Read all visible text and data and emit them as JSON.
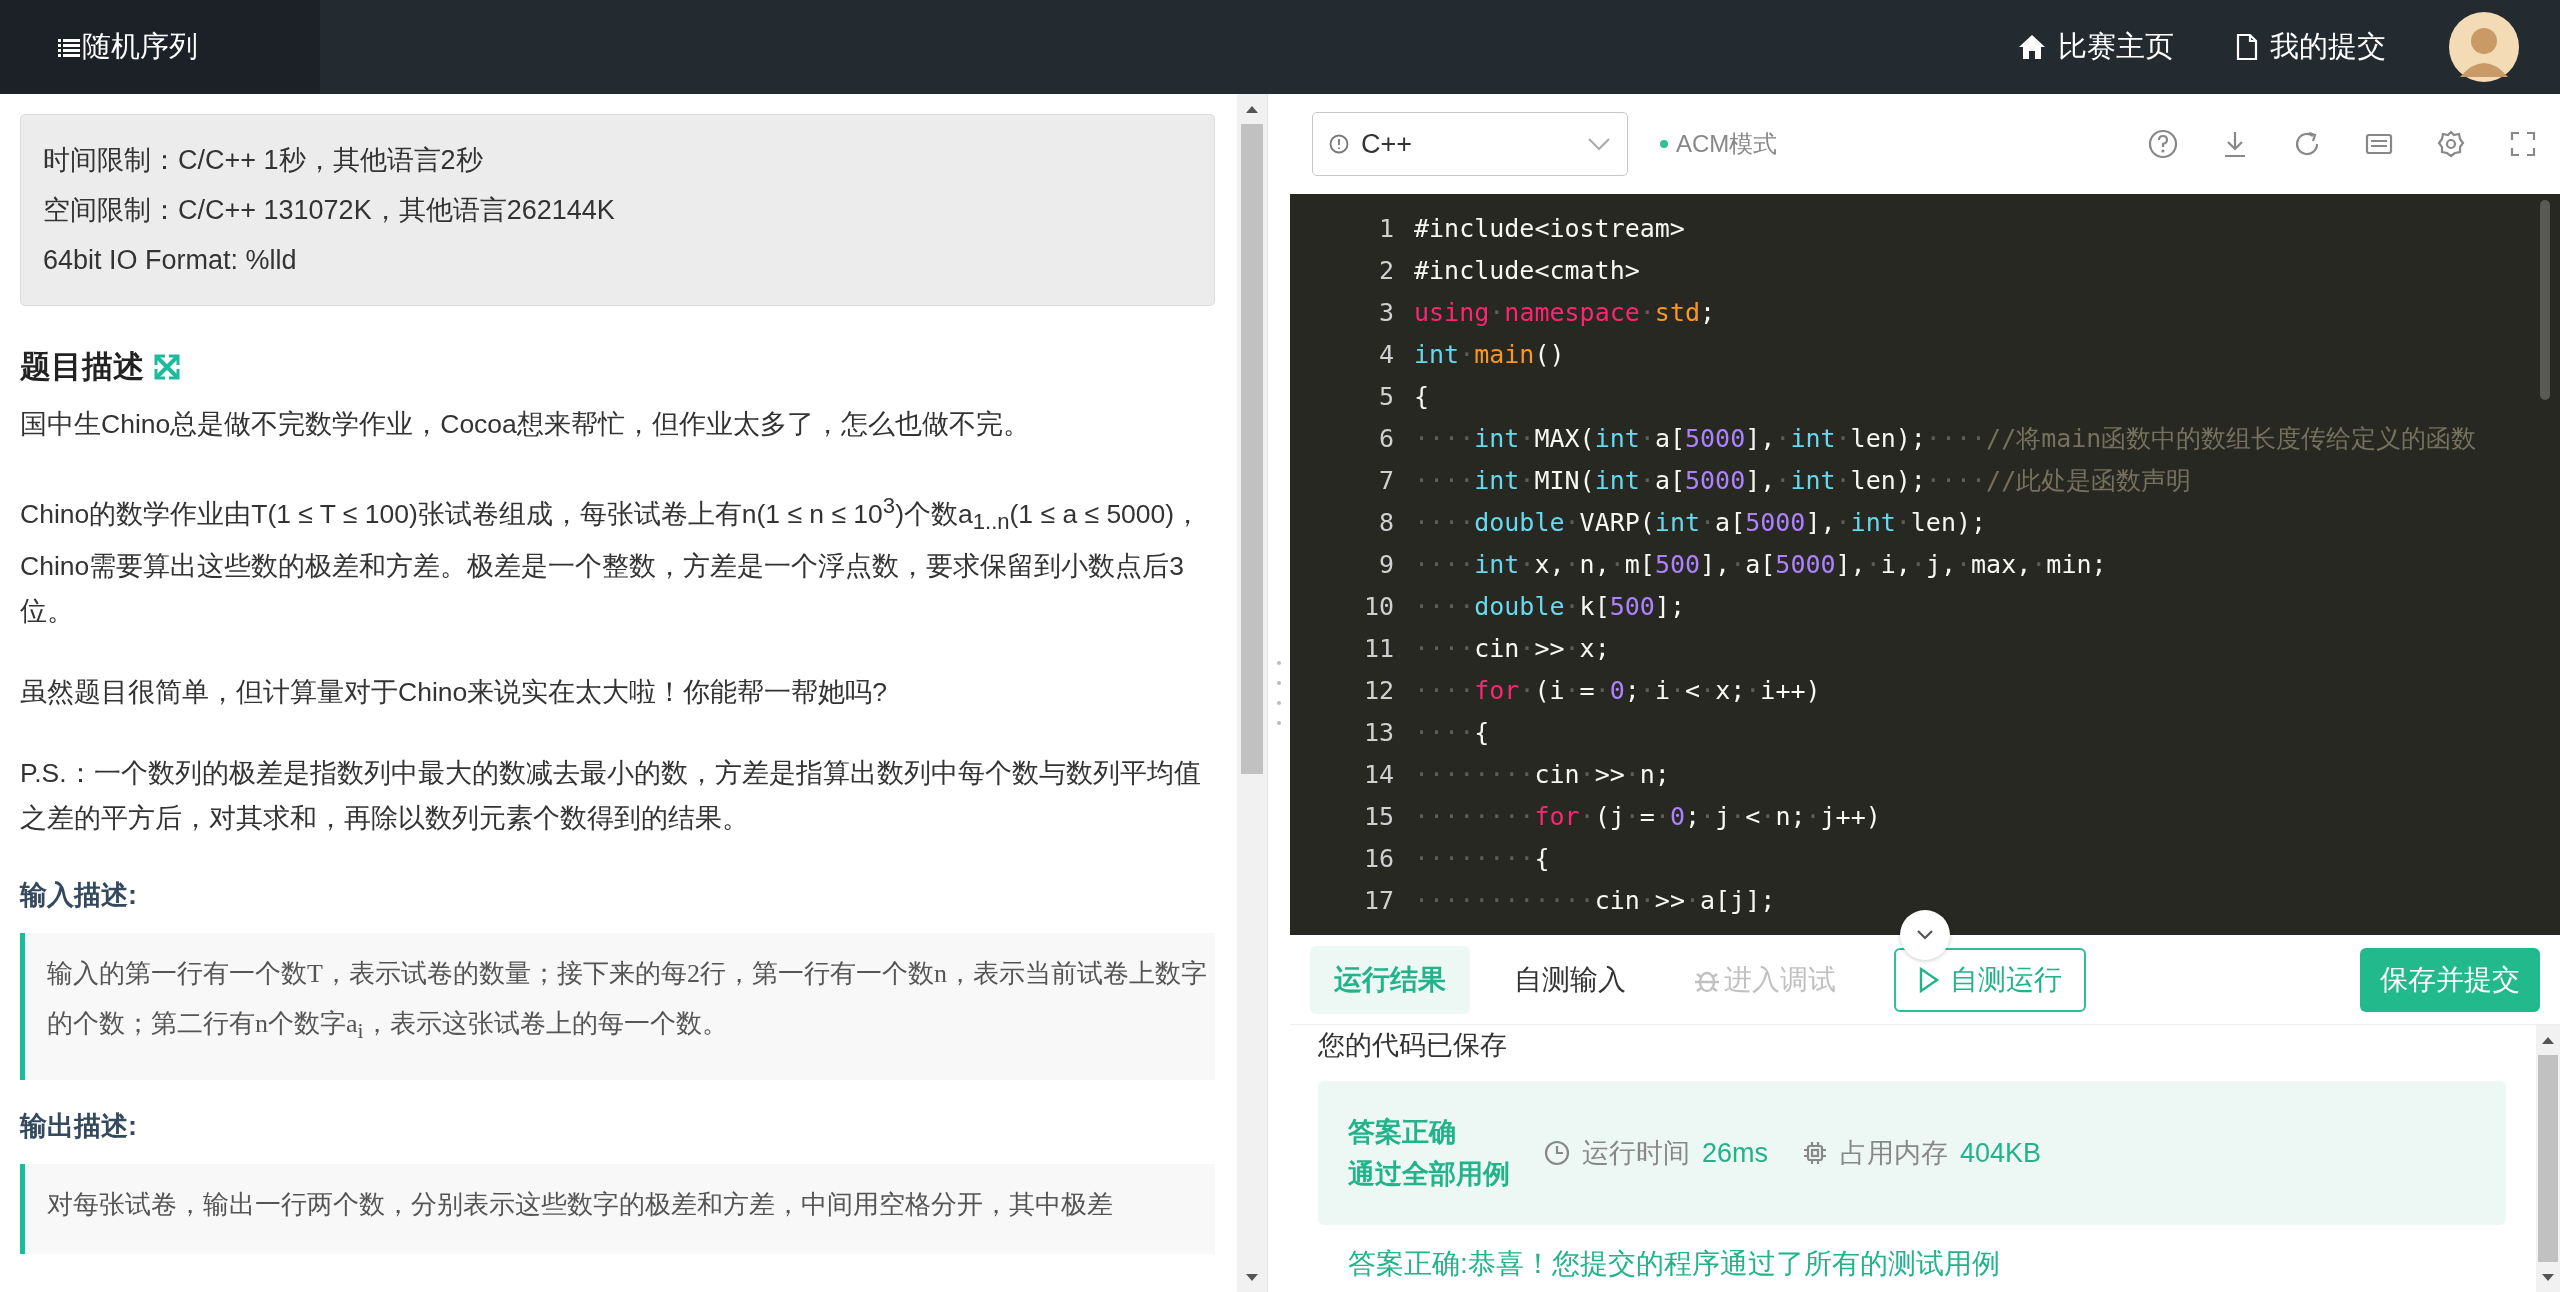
{
  "top_bar": {
    "title": "随机序列",
    "nav": [
      "比赛主页",
      "我的提交"
    ]
  },
  "limits": [
    "时间限制：C/C++ 1秒，其他语言2秒",
    "空间限制：C/C++ 131072K，其他语言262144K",
    "64bit IO Format: %lld"
  ],
  "description": {
    "heading": "题目描述",
    "paragraphs": [
      "国中生Chino总是做不完数学作业，Cocoa想来帮忙，但作业太多了，怎么也做不完。",
      "Chino的数学作业由T(1 ≤ T ≤ 100)张试卷组成，每张试卷上有n(1 ≤ n ≤ 10$^{3}$)个数a$_{1..n}$(1 ≤ a ≤ 5000)，Chino需要算出这些数的极差和方差。极差是一个整数，方差是一个浮点数，要求保留到小数点后3位。",
      "虽然题目很简单，但计算量对于Chino来说实在太大啦！你能帮一帮她吗?",
      "P.S.：一个数列的极差是指数列中最大的数减去最小的数，方差是指算出数列中每个数与数列平均值之差的平方后，对其求和，再除以数列元素个数得到的结果。"
    ]
  },
  "input_description": {
    "heading": "输入描述:",
    "text": "输入的第一行有一个数T，表示试卷的数量；接下来的每2行，第一行有一个数n，表示当前试卷上数字的个数；第二行有n个数字a$_{i}$，表示这张试卷上的每一个数。"
  },
  "output_description": {
    "heading": "输出描述:",
    "text": "对每张试卷，输出一行两个数，分别表示这些数字的极差和方差，中间用空格分开，其中极差"
  },
  "editor": {
    "language": "C++",
    "mode": "ACM模式",
    "lines": [
      {
        "number": "1",
        "tokens": [
          {
            "kind": "plain",
            "text": "#include<iostream>"
          }
        ]
      },
      {
        "number": "2",
        "tokens": [
          {
            "kind": "plain",
            "text": "#include<cmath>"
          }
        ]
      },
      {
        "number": "3",
        "tokens": [
          {
            "kind": "kw",
            "text": "using"
          },
          {
            "kind": "ws",
            "text": "·"
          },
          {
            "kind": "kw",
            "text": "namespace"
          },
          {
            "kind": "ws",
            "text": "·"
          },
          {
            "kind": "fn",
            "text": "std"
          },
          {
            "kind": "plain",
            "text": ";"
          }
        ]
      },
      {
        "number": "4",
        "tokens": [
          {
            "kind": "type",
            "text": "int"
          },
          {
            "kind": "ws",
            "text": "·"
          },
          {
            "kind": "fn",
            "text": "main"
          },
          {
            "kind": "plain",
            "text": "()"
          }
        ]
      },
      {
        "number": "5",
        "tokens": [
          {
            "kind": "plain",
            "text": "{"
          }
        ]
      },
      {
        "number": "6",
        "tokens": [
          {
            "kind": "ws",
            "text": "····"
          },
          {
            "kind": "type",
            "text": "int"
          },
          {
            "kind": "ws",
            "text": "·"
          },
          {
            "kind": "plain",
            "text": "MAX("
          },
          {
            "kind": "type",
            "text": "int"
          },
          {
            "kind": "ws",
            "text": "·"
          },
          {
            "kind": "plain",
            "text": "a["
          },
          {
            "kind": "num",
            "text": "5000"
          },
          {
            "kind": "plain",
            "text": "],"
          },
          {
            "kind": "ws",
            "text": "·"
          },
          {
            "kind": "type",
            "text": "int"
          },
          {
            "kind": "ws",
            "text": "·"
          },
          {
            "kind": "plain",
            "text": "len);"
          },
          {
            "kind": "ws",
            "text": "····"
          },
          {
            "kind": "comment",
            "text": "//将main函数中的数组长度传给定义的函数"
          }
        ]
      },
      {
        "number": "7",
        "tokens": [
          {
            "kind": "ws",
            "text": "····"
          },
          {
            "kind": "type",
            "text": "int"
          },
          {
            "kind": "ws",
            "text": "·"
          },
          {
            "kind": "plain",
            "text": "MIN("
          },
          {
            "kind": "type",
            "text": "int"
          },
          {
            "kind": "ws",
            "text": "·"
          },
          {
            "kind": "plain",
            "text": "a["
          },
          {
            "kind": "num",
            "text": "5000"
          },
          {
            "kind": "plain",
            "text": "],"
          },
          {
            "kind": "ws",
            "text": "·"
          },
          {
            "kind": "type",
            "text": "int"
          },
          {
            "kind": "ws",
            "text": "·"
          },
          {
            "kind": "plain",
            "text": "len);"
          },
          {
            "kind": "ws",
            "text": "····"
          },
          {
            "kind": "comment",
            "text": "//此处是函数声明"
          }
        ]
      },
      {
        "number": "8",
        "tokens": [
          {
            "kind": "ws",
            "text": "····"
          },
          {
            "kind": "type",
            "text": "double"
          },
          {
            "kind": "ws",
            "text": "·"
          },
          {
            "kind": "plain",
            "text": "VARP("
          },
          {
            "kind": "type",
            "text": "int"
          },
          {
            "kind": "ws",
            "text": "·"
          },
          {
            "kind": "plain",
            "text": "a["
          },
          {
            "kind": "num",
            "text": "5000"
          },
          {
            "kind": "plain",
            "text": "],"
          },
          {
            "kind": "ws",
            "text": "·"
          },
          {
            "kind": "type",
            "text": "int"
          },
          {
            "kind": "ws",
            "text": "·"
          },
          {
            "kind": "plain",
            "text": "len);"
          }
        ]
      },
      {
        "number": "9",
        "tokens": [
          {
            "kind": "ws",
            "text": "····"
          },
          {
            "kind": "type",
            "text": "int"
          },
          {
            "kind": "ws",
            "text": "·"
          },
          {
            "kind": "plain",
            "text": "x,"
          },
          {
            "kind": "ws",
            "text": "·"
          },
          {
            "kind": "plain",
            "text": "n,"
          },
          {
            "kind": "ws",
            "text": "·"
          },
          {
            "kind": "plain",
            "text": "m["
          },
          {
            "kind": "num",
            "text": "500"
          },
          {
            "kind": "plain",
            "text": "],"
          },
          {
            "kind": "ws",
            "text": "·"
          },
          {
            "kind": "plain",
            "text": "a["
          },
          {
            "kind": "num",
            "text": "5000"
          },
          {
            "kind": "plain",
            "text": "],"
          },
          {
            "kind": "ws",
            "text": "·"
          },
          {
            "kind": "plain",
            "text": "i,"
          },
          {
            "kind": "ws",
            "text": "·"
          },
          {
            "kind": "plain",
            "text": "j,"
          },
          {
            "kind": "ws",
            "text": "·"
          },
          {
            "kind": "plain",
            "text": "max,"
          },
          {
            "kind": "ws",
            "text": "·"
          },
          {
            "kind": "plain",
            "text": "min;"
          }
        ]
      },
      {
        "number": "10",
        "tokens": [
          {
            "kind": "ws",
            "text": "····"
          },
          {
            "kind": "type",
            "text": "double"
          },
          {
            "kind": "ws",
            "text": "·"
          },
          {
            "kind": "plain",
            "text": "k["
          },
          {
            "kind": "num",
            "text": "500"
          },
          {
            "kind": "plain",
            "text": "];"
          }
        ]
      },
      {
        "number": "11",
        "tokens": [
          {
            "kind": "ws",
            "text": "····"
          },
          {
            "kind": "plain",
            "text": "cin"
          },
          {
            "kind": "ws",
            "text": "·"
          },
          {
            "kind": "plain",
            "text": ">>"
          },
          {
            "kind": "ws",
            "text": "·"
          },
          {
            "kind": "plain",
            "text": "x;"
          }
        ]
      },
      {
        "number": "12",
        "tokens": [
          {
            "kind": "ws",
            "text": "····"
          },
          {
            "kind": "kw",
            "text": "for"
          },
          {
            "kind": "ws",
            "text": "·"
          },
          {
            "kind": "plain",
            "text": "(i"
          },
          {
            "kind": "ws",
            "text": "·"
          },
          {
            "kind": "plain",
            "text": "="
          },
          {
            "kind": "ws",
            "text": "·"
          },
          {
            "kind": "num",
            "text": "0"
          },
          {
            "kind": "plain",
            "text": ";"
          },
          {
            "kind": "ws",
            "text": "·"
          },
          {
            "kind": "plain",
            "text": "i"
          },
          {
            "kind": "ws",
            "text": "·"
          },
          {
            "kind": "plain",
            "text": "<"
          },
          {
            "kind": "ws",
            "text": "·"
          },
          {
            "kind": "plain",
            "text": "x;"
          },
          {
            "kind": "ws",
            "text": "·"
          },
          {
            "kind": "plain",
            "text": "i++)"
          }
        ]
      },
      {
        "number": "13",
        "tokens": [
          {
            "kind": "ws",
            "text": "····"
          },
          {
            "kind": "plain",
            "text": "{"
          }
        ]
      },
      {
        "number": "14",
        "tokens": [
          {
            "kind": "ws",
            "text": "········"
          },
          {
            "kind": "plain",
            "text": "cin"
          },
          {
            "kind": "ws",
            "text": "·"
          },
          {
            "kind": "plain",
            "text": ">>"
          },
          {
            "kind": "ws",
            "text": "·"
          },
          {
            "kind": "plain",
            "text": "n;"
          }
        ]
      },
      {
        "number": "15",
        "tokens": [
          {
            "kind": "ws",
            "text": "········"
          },
          {
            "kind": "kw",
            "text": "for"
          },
          {
            "kind": "ws",
            "text": "·"
          },
          {
            "kind": "plain",
            "text": "(j"
          },
          {
            "kind": "ws",
            "text": "·"
          },
          {
            "kind": "plain",
            "text": "="
          },
          {
            "kind": "ws",
            "text": "·"
          },
          {
            "kind": "num",
            "text": "0"
          },
          {
            "kind": "plain",
            "text": ";"
          },
          {
            "kind": "ws",
            "text": "·"
          },
          {
            "kind": "plain",
            "text": "j"
          },
          {
            "kind": "ws",
            "text": "·"
          },
          {
            "kind": "plain",
            "text": "<"
          },
          {
            "kind": "ws",
            "text": "·"
          },
          {
            "kind": "plain",
            "text": "n;"
          },
          {
            "kind": "ws",
            "text": "·"
          },
          {
            "kind": "plain",
            "text": "j++)"
          }
        ]
      },
      {
        "number": "16",
        "tokens": [
          {
            "kind": "ws",
            "text": "········"
          },
          {
            "kind": "plain",
            "text": "{"
          }
        ]
      },
      {
        "number": "17",
        "tokens": [
          {
            "kind": "ws",
            "text": "············"
          },
          {
            "kind": "plain",
            "text": "cin"
          },
          {
            "kind": "ws",
            "text": "·"
          },
          {
            "kind": "plain",
            "text": ">>"
          },
          {
            "kind": "ws",
            "text": "·"
          },
          {
            "kind": "plain",
            "text": "a[j];"
          }
        ]
      }
    ]
  },
  "console": {
    "tabs": [
      {
        "label": "运行结果",
        "selected": true,
        "disabled": false
      },
      {
        "label": "自测输入",
        "selected": false,
        "disabled": false
      },
      {
        "label": "进入调试",
        "selected": false,
        "disabled": true
      }
    ],
    "buttons": [
      {
        "label": "自测运行",
        "kind": "outline"
      },
      {
        "label": "保存并提交",
        "kind": "primary"
      }
    ],
    "saved_message": "您的代码已保存",
    "result": {
      "status_lines": [
        "答案正确",
        "通过全部用例"
      ],
      "metrics": [
        {
          "label": "运行时间",
          "value": "26ms"
        },
        {
          "label": "占用内存",
          "value": "404KB"
        }
      ]
    },
    "message": "答案正确:恭喜！您提交的程序通过了所有的测试用例"
  }
}
